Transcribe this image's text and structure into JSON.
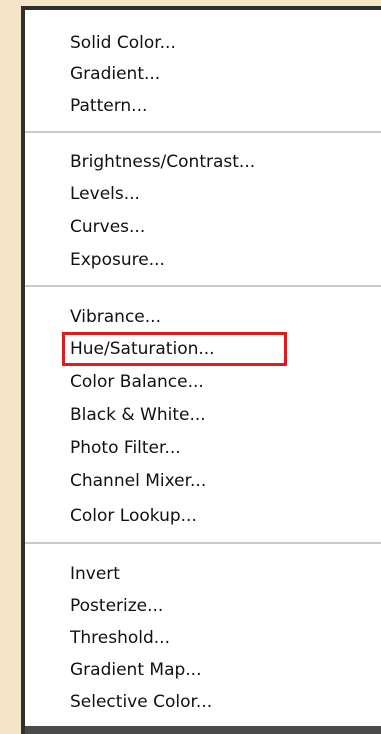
{
  "menu": {
    "groups": [
      {
        "items": [
          {
            "label": "Solid Color..."
          },
          {
            "label": "Gradient..."
          },
          {
            "label": "Pattern..."
          }
        ]
      },
      {
        "items": [
          {
            "label": "Brightness/Contrast..."
          },
          {
            "label": "Levels..."
          },
          {
            "label": "Curves..."
          },
          {
            "label": "Exposure..."
          }
        ]
      },
      {
        "items": [
          {
            "label": "Vibrance..."
          },
          {
            "label": "Hue/Saturation..."
          },
          {
            "label": "Color Balance..."
          },
          {
            "label": "Black & White..."
          },
          {
            "label": "Photo Filter..."
          },
          {
            "label": "Channel Mixer..."
          },
          {
            "label": "Color Lookup..."
          }
        ]
      },
      {
        "items": [
          {
            "label": "Invert"
          },
          {
            "label": "Posterize..."
          },
          {
            "label": "Threshold..."
          },
          {
            "label": "Gradient Map..."
          },
          {
            "label": "Selective Color..."
          }
        ]
      }
    ],
    "highlighted_item": "Hue/Saturation...",
    "colors": {
      "background": "#f5e4c7",
      "menu": "#ffffff",
      "highlight_border": "#e01b1b",
      "separator": "#c9c9c9"
    }
  }
}
